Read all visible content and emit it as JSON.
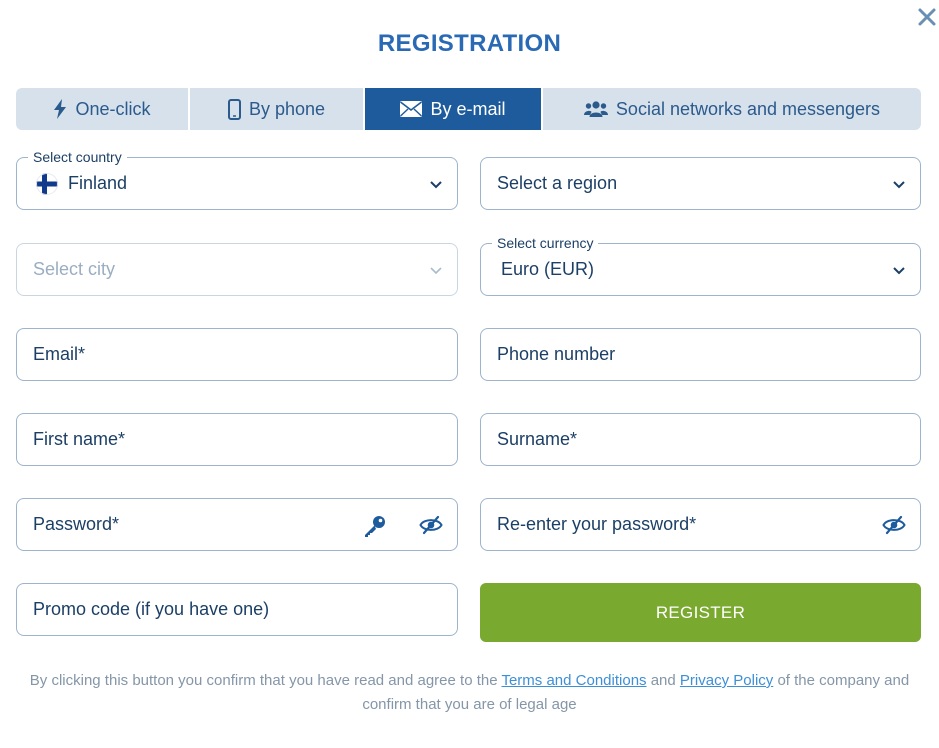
{
  "header": {
    "title": "REGISTRATION",
    "close_icon": "close-icon"
  },
  "tabs": [
    {
      "label": "One-click",
      "icon": "lightning-icon",
      "active": false
    },
    {
      "label": "By phone",
      "icon": "phone-icon",
      "active": false
    },
    {
      "label": "By e-mail",
      "icon": "envelope-icon",
      "active": true
    },
    {
      "label": "Social networks and messengers",
      "icon": "users-icon",
      "active": false
    }
  ],
  "form": {
    "country": {
      "label": "Select country",
      "value": "Finland",
      "flag": "finland-flag-icon"
    },
    "region": {
      "placeholder": "Select a region"
    },
    "city": {
      "placeholder": "Select city"
    },
    "currency": {
      "label": "Select currency",
      "value": "Euro (EUR)"
    },
    "email": {
      "placeholder": "Email*"
    },
    "phone": {
      "placeholder": "Phone number"
    },
    "first_name": {
      "placeholder": "First name*"
    },
    "surname": {
      "placeholder": "Surname*"
    },
    "password": {
      "placeholder": "Password*"
    },
    "password_confirm": {
      "placeholder": "Re-enter your password*"
    },
    "promo": {
      "placeholder": "Promo code (if you have one)"
    },
    "register_label": "REGISTER"
  },
  "disclaimer": {
    "part1": "By clicking this button you confirm that you have read and agree to the",
    "terms_link": "Terms and Conditions",
    "and": "and",
    "privacy_link": "Privacy Policy",
    "part2": "of the company and confirm that you are of legal age"
  },
  "colors": {
    "title": "#2a6ab5",
    "tab_active": "#1e5b9c",
    "tab_bg": "#d6e1ec",
    "register": "#7aa92f",
    "link": "#3d8fd6",
    "border": "#9db4cc"
  }
}
